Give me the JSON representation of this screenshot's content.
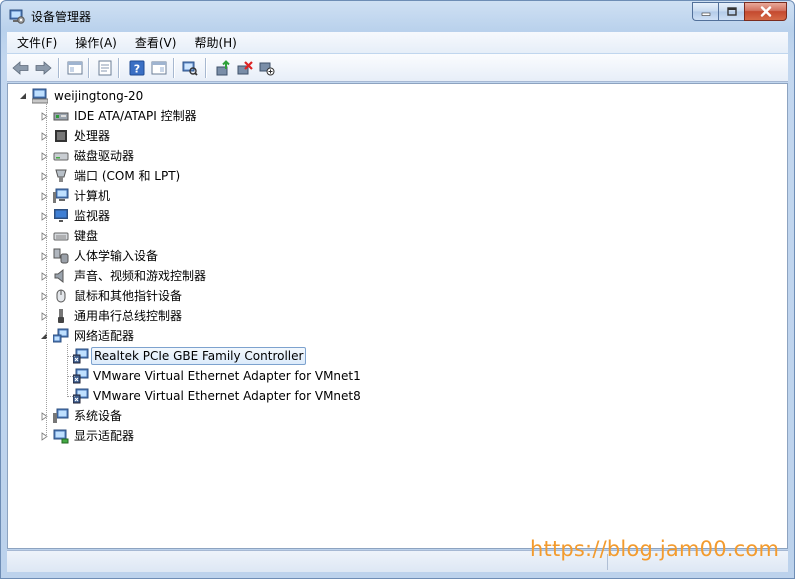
{
  "window": {
    "title": "设备管理器"
  },
  "menu": [
    "文件(F)",
    "操作(A)",
    "查看(V)",
    "帮助(H)"
  ],
  "tree": {
    "root": "weijingtong-20",
    "categories": [
      {
        "label": "IDE ATA/ATAPI 控制器",
        "icon": "ide-controller-icon"
      },
      {
        "label": "处理器",
        "icon": "processor-icon"
      },
      {
        "label": "磁盘驱动器",
        "icon": "disk-drive-icon"
      },
      {
        "label": "端口 (COM 和 LPT)",
        "icon": "port-icon"
      },
      {
        "label": "计算机",
        "icon": "computer-icon"
      },
      {
        "label": "监视器",
        "icon": "monitor-icon"
      },
      {
        "label": "键盘",
        "icon": "keyboard-icon"
      },
      {
        "label": "人体学输入设备",
        "icon": "hid-icon"
      },
      {
        "label": "声音、视频和游戏控制器",
        "icon": "sound-icon"
      },
      {
        "label": "鼠标和其他指针设备",
        "icon": "mouse-icon"
      },
      {
        "label": "通用串行总线控制器",
        "icon": "usb-icon"
      },
      {
        "label": "网络适配器",
        "icon": "network-adapter-icon",
        "expanded": true
      },
      {
        "label": "系统设备",
        "icon": "system-device-icon"
      },
      {
        "label": "显示适配器",
        "icon": "display-adapter-icon"
      }
    ],
    "network_children": [
      "Realtek PCIe GBE Family Controller",
      "VMware Virtual Ethernet Adapter for VMnet1",
      "VMware Virtual Ethernet Adapter for VMnet8"
    ],
    "selected_child": 0
  },
  "watermark": "https://blog.jam00.com"
}
